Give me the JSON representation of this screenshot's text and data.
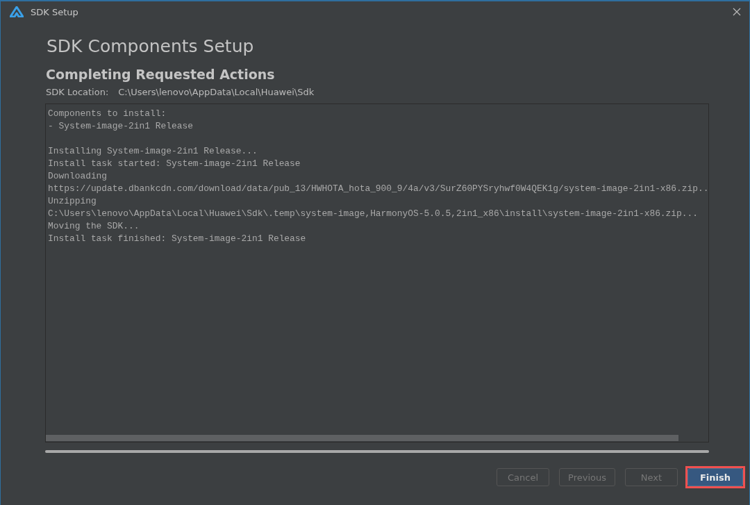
{
  "window": {
    "title": "SDK Setup"
  },
  "page_title": "SDK Components Setup",
  "section_title": "Completing Requested Actions",
  "sdk_location": {
    "label": "SDK Location:",
    "value": "C:\\Users\\lenovo\\AppData\\Local\\Huawei\\Sdk"
  },
  "log_blocks": [
    [
      "Components to install:",
      "- System-image-2in1 Release"
    ],
    [
      "Installing System-image-2in1 Release...",
      "Install task started: System-image-2in1 Release",
      "Downloading",
      "https://update.dbankcdn.com/download/data/pub_13/HWHOTA_hota_900_9/4a/v3/SurZ60PYSryhwf0W4QEK1g/system-image-2in1-x86.zip..",
      "Unzipping",
      "C:\\Users\\lenovo\\AppData\\Local\\Huawei\\Sdk\\.temp\\system-image,HarmonyOS-5.0.5,2in1_x86\\install\\system-image-2in1-x86.zip...",
      "Moving the SDK...",
      "Install task finished: System-image-2in1 Release"
    ]
  ],
  "progress": {
    "level": 1
  },
  "buttons": [
    {
      "label": "Cancel",
      "disabled": true,
      "default": false,
      "highlighted": false
    },
    {
      "label": "Previous",
      "disabled": true,
      "default": false,
      "highlighted": false
    },
    {
      "label": "Next",
      "disabled": true,
      "default": false,
      "highlighted": false
    },
    {
      "label": "Finish",
      "disabled": false,
      "default": true,
      "highlighted": true
    }
  ]
}
